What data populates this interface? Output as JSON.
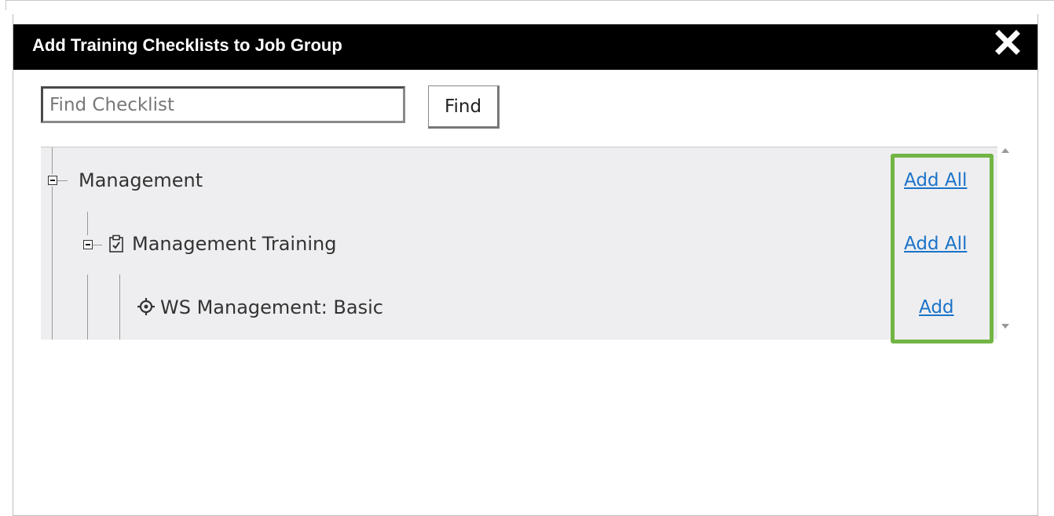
{
  "dialog": {
    "title": "Add Training Checklists to Job Group",
    "close_icon": "close-icon"
  },
  "search": {
    "placeholder": "Find Checklist",
    "value": "",
    "find_label": "Find"
  },
  "tree": {
    "nodes": [
      {
        "label": "Management",
        "action": "Add All",
        "icon": "expand-collapse-icon",
        "expanded": true
      },
      {
        "label": "Management Training",
        "action": "Add All",
        "icon": "checklist-icon",
        "expanded": true
      },
      {
        "label": "WS Management: Basic",
        "action": "Add",
        "icon": "target-icon"
      }
    ]
  },
  "colors": {
    "titlebar": "#000000",
    "link": "#1a73c9",
    "highlight": "#72b544",
    "tree_bg": "#eeeef0"
  }
}
